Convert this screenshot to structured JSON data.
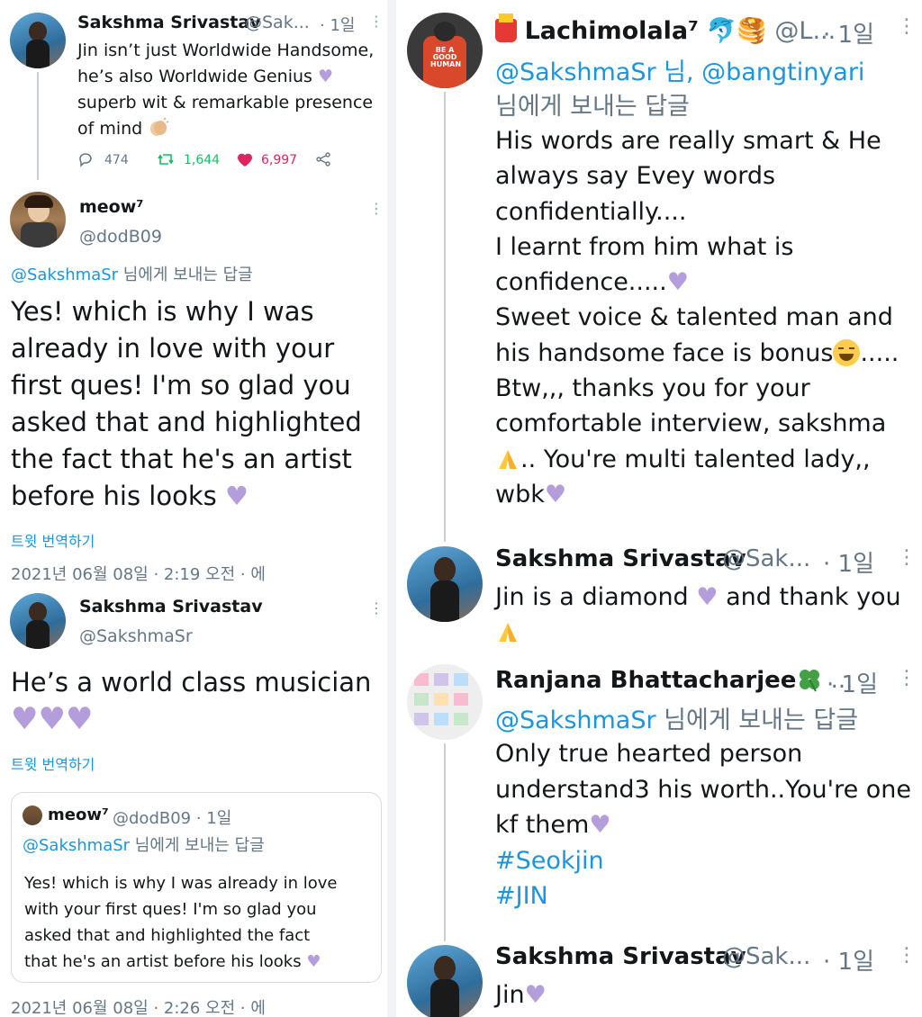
{
  "left": {
    "tweet1": {
      "name": "Sakshma Srivastav",
      "handle": "@Sak...",
      "time": "· 1일",
      "lines": [
        "Jin isn’t just Worldwide Handsome,",
        "he’s also Worldwide Genius",
        "superb wit & remarkable presence",
        "of mind"
      ],
      "replies": "474",
      "retweets": "1,644",
      "likes": "6,997"
    },
    "tweet2": {
      "name": "meow⁷",
      "handle": "@dodB09",
      "reply_to_handle": "@SakshmaSr",
      "reply_to_suffix": " 님에게 보내는 답글",
      "lines": [
        "Yes! which is why I was",
        "already in love with your",
        "first ques! I'm so glad you",
        "asked that and highlighted",
        "the fact that he's an artist",
        "before his looks"
      ],
      "translate": "트윗 번역하기",
      "timestamp": "2021년 06월 08일 · 2:19 오전 · 에"
    },
    "tweet3": {
      "name": "Sakshma Srivastav",
      "handle": "@SakshmaSr",
      "lines": [
        "He’s a world class musician"
      ],
      "translate": "트윗 번역하기",
      "quote": {
        "name": "meow⁷",
        "meta": "@dodB09 · 1일",
        "reply_to_handle": "@SakshmaSr",
        "reply_to_suffix": " 님에게 보내는 답글",
        "lines": [
          "Yes! which is why I was already in love",
          "with your first ques! I'm so glad you",
          "asked that and highlighted the fact",
          "that he's an artist before his looks"
        ]
      },
      "timestamp": "2021년 06월 08일 · 2:26 오전 · 에"
    }
  },
  "right": {
    "tweet1": {
      "name": "Lachimolala⁷",
      "handle": "@L...",
      "time": "· 1일",
      "reply_line": "@SakshmaSr 님, @bangtinyari",
      "reply_suffix": "님에게 보내는 답글",
      "lines": [
        "His words are really smart & He",
        "always say Evey words",
        "confidentially....",
        "I learnt from him what is",
        "confidence.....",
        "Sweet voice & talented man and",
        "his handsome face is bonus",
        "Btw,,, thanks you for your",
        "comfortable interview, sakshma",
        ".. You're multi talented lady,,",
        "wbk"
      ],
      "tail_dots": "....."
    },
    "tweet2": {
      "name": "Sakshma Srivastav",
      "handle": "@Sak...",
      "time": "· 1일",
      "line1a": "Jin is a diamond",
      "line1b": "and thank you"
    },
    "tweet3": {
      "name": "Ranjana Bhattacharjee",
      "tail": "...",
      "time": "· 1일",
      "reply_to_handle": "@SakshmaSr",
      "reply_to_suffix": " 님에게 보내는 답글",
      "lines": [
        "Only true hearted person",
        "understand3 his worth..You're one",
        "kf them"
      ],
      "hashtags": [
        "#Seokjin",
        "#JIN"
      ]
    },
    "tweet4": {
      "name": "Sakshma Srivastav",
      "handle": "@Sak...",
      "time": "· 1일",
      "line1": "Jin"
    }
  },
  "colors": {
    "link": "#1b95e0",
    "retweet": "#17bf63",
    "like": "#e0245e",
    "purple_heart": "#b39ddb"
  }
}
